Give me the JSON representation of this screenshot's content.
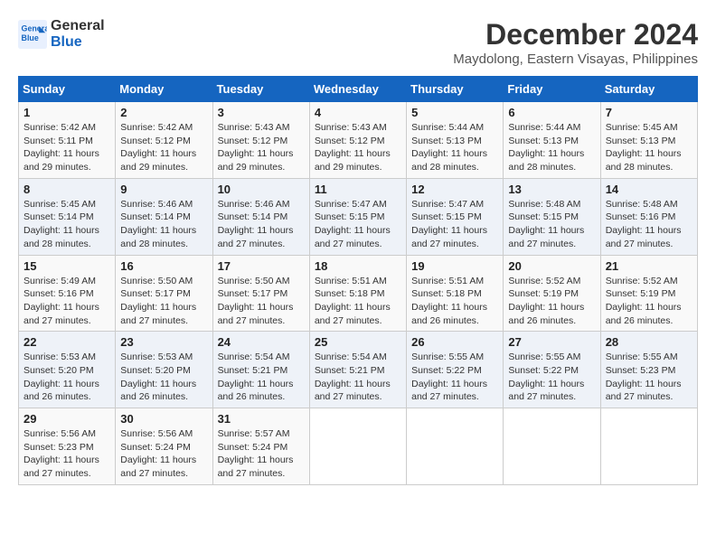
{
  "header": {
    "logo_line1": "General",
    "logo_line2": "Blue",
    "month_year": "December 2024",
    "location": "Maydolong, Eastern Visayas, Philippines"
  },
  "days_of_week": [
    "Sunday",
    "Monday",
    "Tuesday",
    "Wednesday",
    "Thursday",
    "Friday",
    "Saturday"
  ],
  "weeks": [
    [
      {
        "day": "1",
        "sunrise": "5:42 AM",
        "sunset": "5:11 PM",
        "daylight": "11 hours and 29 minutes."
      },
      {
        "day": "2",
        "sunrise": "5:42 AM",
        "sunset": "5:12 PM",
        "daylight": "11 hours and 29 minutes."
      },
      {
        "day": "3",
        "sunrise": "5:43 AM",
        "sunset": "5:12 PM",
        "daylight": "11 hours and 29 minutes."
      },
      {
        "day": "4",
        "sunrise": "5:43 AM",
        "sunset": "5:12 PM",
        "daylight": "11 hours and 29 minutes."
      },
      {
        "day": "5",
        "sunrise": "5:44 AM",
        "sunset": "5:13 PM",
        "daylight": "11 hours and 28 minutes."
      },
      {
        "day": "6",
        "sunrise": "5:44 AM",
        "sunset": "5:13 PM",
        "daylight": "11 hours and 28 minutes."
      },
      {
        "day": "7",
        "sunrise": "5:45 AM",
        "sunset": "5:13 PM",
        "daylight": "11 hours and 28 minutes."
      }
    ],
    [
      {
        "day": "8",
        "sunrise": "5:45 AM",
        "sunset": "5:14 PM",
        "daylight": "11 hours and 28 minutes."
      },
      {
        "day": "9",
        "sunrise": "5:46 AM",
        "sunset": "5:14 PM",
        "daylight": "11 hours and 28 minutes."
      },
      {
        "day": "10",
        "sunrise": "5:46 AM",
        "sunset": "5:14 PM",
        "daylight": "11 hours and 27 minutes."
      },
      {
        "day": "11",
        "sunrise": "5:47 AM",
        "sunset": "5:15 PM",
        "daylight": "11 hours and 27 minutes."
      },
      {
        "day": "12",
        "sunrise": "5:47 AM",
        "sunset": "5:15 PM",
        "daylight": "11 hours and 27 minutes."
      },
      {
        "day": "13",
        "sunrise": "5:48 AM",
        "sunset": "5:15 PM",
        "daylight": "11 hours and 27 minutes."
      },
      {
        "day": "14",
        "sunrise": "5:48 AM",
        "sunset": "5:16 PM",
        "daylight": "11 hours and 27 minutes."
      }
    ],
    [
      {
        "day": "15",
        "sunrise": "5:49 AM",
        "sunset": "5:16 PM",
        "daylight": "11 hours and 27 minutes."
      },
      {
        "day": "16",
        "sunrise": "5:50 AM",
        "sunset": "5:17 PM",
        "daylight": "11 hours and 27 minutes."
      },
      {
        "day": "17",
        "sunrise": "5:50 AM",
        "sunset": "5:17 PM",
        "daylight": "11 hours and 27 minutes."
      },
      {
        "day": "18",
        "sunrise": "5:51 AM",
        "sunset": "5:18 PM",
        "daylight": "11 hours and 27 minutes."
      },
      {
        "day": "19",
        "sunrise": "5:51 AM",
        "sunset": "5:18 PM",
        "daylight": "11 hours and 26 minutes."
      },
      {
        "day": "20",
        "sunrise": "5:52 AM",
        "sunset": "5:19 PM",
        "daylight": "11 hours and 26 minutes."
      },
      {
        "day": "21",
        "sunrise": "5:52 AM",
        "sunset": "5:19 PM",
        "daylight": "11 hours and 26 minutes."
      }
    ],
    [
      {
        "day": "22",
        "sunrise": "5:53 AM",
        "sunset": "5:20 PM",
        "daylight": "11 hours and 26 minutes."
      },
      {
        "day": "23",
        "sunrise": "5:53 AM",
        "sunset": "5:20 PM",
        "daylight": "11 hours and 26 minutes."
      },
      {
        "day": "24",
        "sunrise": "5:54 AM",
        "sunset": "5:21 PM",
        "daylight": "11 hours and 26 minutes."
      },
      {
        "day": "25",
        "sunrise": "5:54 AM",
        "sunset": "5:21 PM",
        "daylight": "11 hours and 27 minutes."
      },
      {
        "day": "26",
        "sunrise": "5:55 AM",
        "sunset": "5:22 PM",
        "daylight": "11 hours and 27 minutes."
      },
      {
        "day": "27",
        "sunrise": "5:55 AM",
        "sunset": "5:22 PM",
        "daylight": "11 hours and 27 minutes."
      },
      {
        "day": "28",
        "sunrise": "5:55 AM",
        "sunset": "5:23 PM",
        "daylight": "11 hours and 27 minutes."
      }
    ],
    [
      {
        "day": "29",
        "sunrise": "5:56 AM",
        "sunset": "5:23 PM",
        "daylight": "11 hours and 27 minutes."
      },
      {
        "day": "30",
        "sunrise": "5:56 AM",
        "sunset": "5:24 PM",
        "daylight": "11 hours and 27 minutes."
      },
      {
        "day": "31",
        "sunrise": "5:57 AM",
        "sunset": "5:24 PM",
        "daylight": "11 hours and 27 minutes."
      },
      null,
      null,
      null,
      null
    ]
  ],
  "labels": {
    "sunrise": "Sunrise:",
    "sunset": "Sunset:",
    "daylight": "Daylight:"
  }
}
